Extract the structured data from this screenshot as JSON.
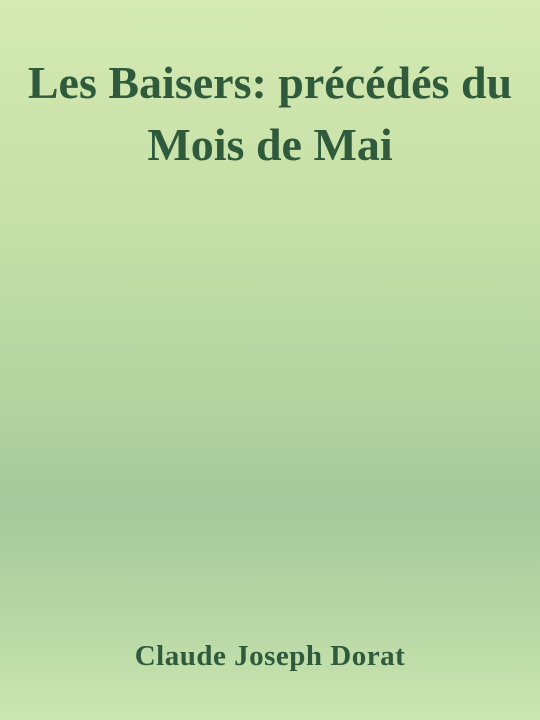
{
  "book": {
    "title": "Les Baisers: précédés du Mois de Mai",
    "author": "Claude Joseph Dorat"
  },
  "colors": {
    "text": "#2f5a3c",
    "background_top": "#d4eab2",
    "background_middle": "#a6c89c",
    "background_bottom": "#cbe6b0"
  }
}
